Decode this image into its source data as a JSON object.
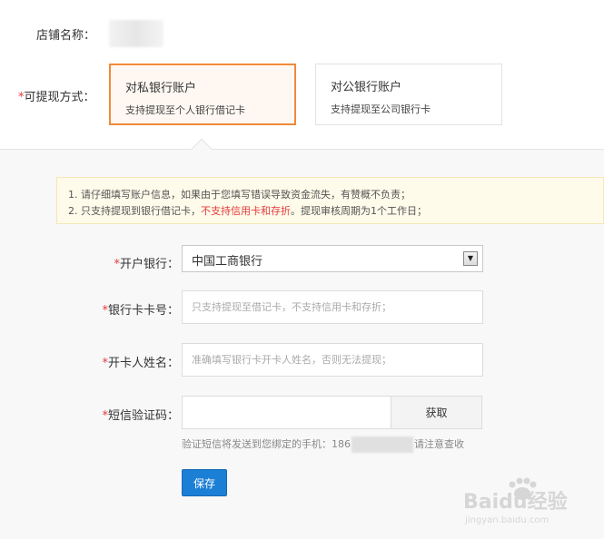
{
  "store": {
    "label": "店铺名称："
  },
  "withdraw": {
    "label": "可提现方式：",
    "required_mark": "*",
    "options": [
      {
        "title": "对私银行账户",
        "desc": "支持提现至个人银行借记卡",
        "selected": true
      },
      {
        "title": "对公银行账户",
        "desc": "支持提现至公司银行卡",
        "selected": false
      }
    ]
  },
  "notice": {
    "line1": "1. 请仔细填写账户信息，如果由于您填写错误导致资金流失，有赞概不负责；",
    "line2_a": "2. 只支持提现到银行借记卡，",
    "line2_warn": "不支持信用卡和存折",
    "line2_b": "。提现审核周期为1个工作日；"
  },
  "form": {
    "required_mark": "*",
    "bank": {
      "label": "开户银行：",
      "value": "中国工商银行"
    },
    "card_no": {
      "label": "银行卡卡号：",
      "placeholder": "只支持提现至借记卡，不支持信用卡和存折；"
    },
    "holder": {
      "label": "开卡人姓名：",
      "placeholder": "准确填写银行卡开卡人姓名，否则无法提现；"
    },
    "sms": {
      "label": "短信验证码：",
      "button": "获取",
      "hint_prefix": "验证短信将发送到您绑定的手机：186",
      "hint_suffix": "请注意查收"
    },
    "save": "保存"
  },
  "watermark": {
    "text": "Baidu经验",
    "sub": "jingyan.baidu.com"
  },
  "colors": {
    "accent": "#1c7fd6",
    "selected_border": "#f08a3a",
    "required": "#e4393c"
  }
}
